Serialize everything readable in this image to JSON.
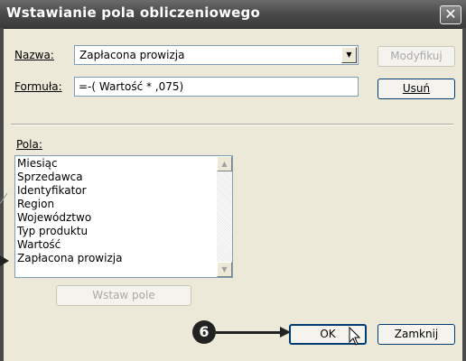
{
  "dialog": {
    "title": "Wstawianie pola obliczeniowego",
    "close_glyph": "✕"
  },
  "name_field": {
    "label": "Nazwa:",
    "value": "Zapłacona prowizja"
  },
  "formula_field": {
    "label": "Formuła:",
    "value": "=-( Wartość * ,075)"
  },
  "buttons": {
    "modify": "Modyfikuj",
    "delete": "Usuń",
    "insert_field": "Wstaw pole",
    "ok": "OK",
    "close": "Zamknij"
  },
  "fields_list": {
    "label": "Pola:",
    "items": [
      "Miesiąc",
      "Sprzedawca",
      "Identyfikator",
      "Region",
      "Województwo",
      "Typ produktu",
      "Wartość",
      "Zapłacona prowizja"
    ]
  },
  "callout": {
    "number": "6"
  },
  "icons": {
    "dropdown": "chevron-down-icon",
    "scroll_up": "arrow-up-icon",
    "scroll_down": "arrow-down-icon",
    "cursor": "mouse-pointer-icon"
  },
  "colors": {
    "titlebar": "#4c4c4c",
    "dialog_bg": "#ece9d8",
    "field_border": "#7f9db9",
    "button_border": "#003c74"
  }
}
